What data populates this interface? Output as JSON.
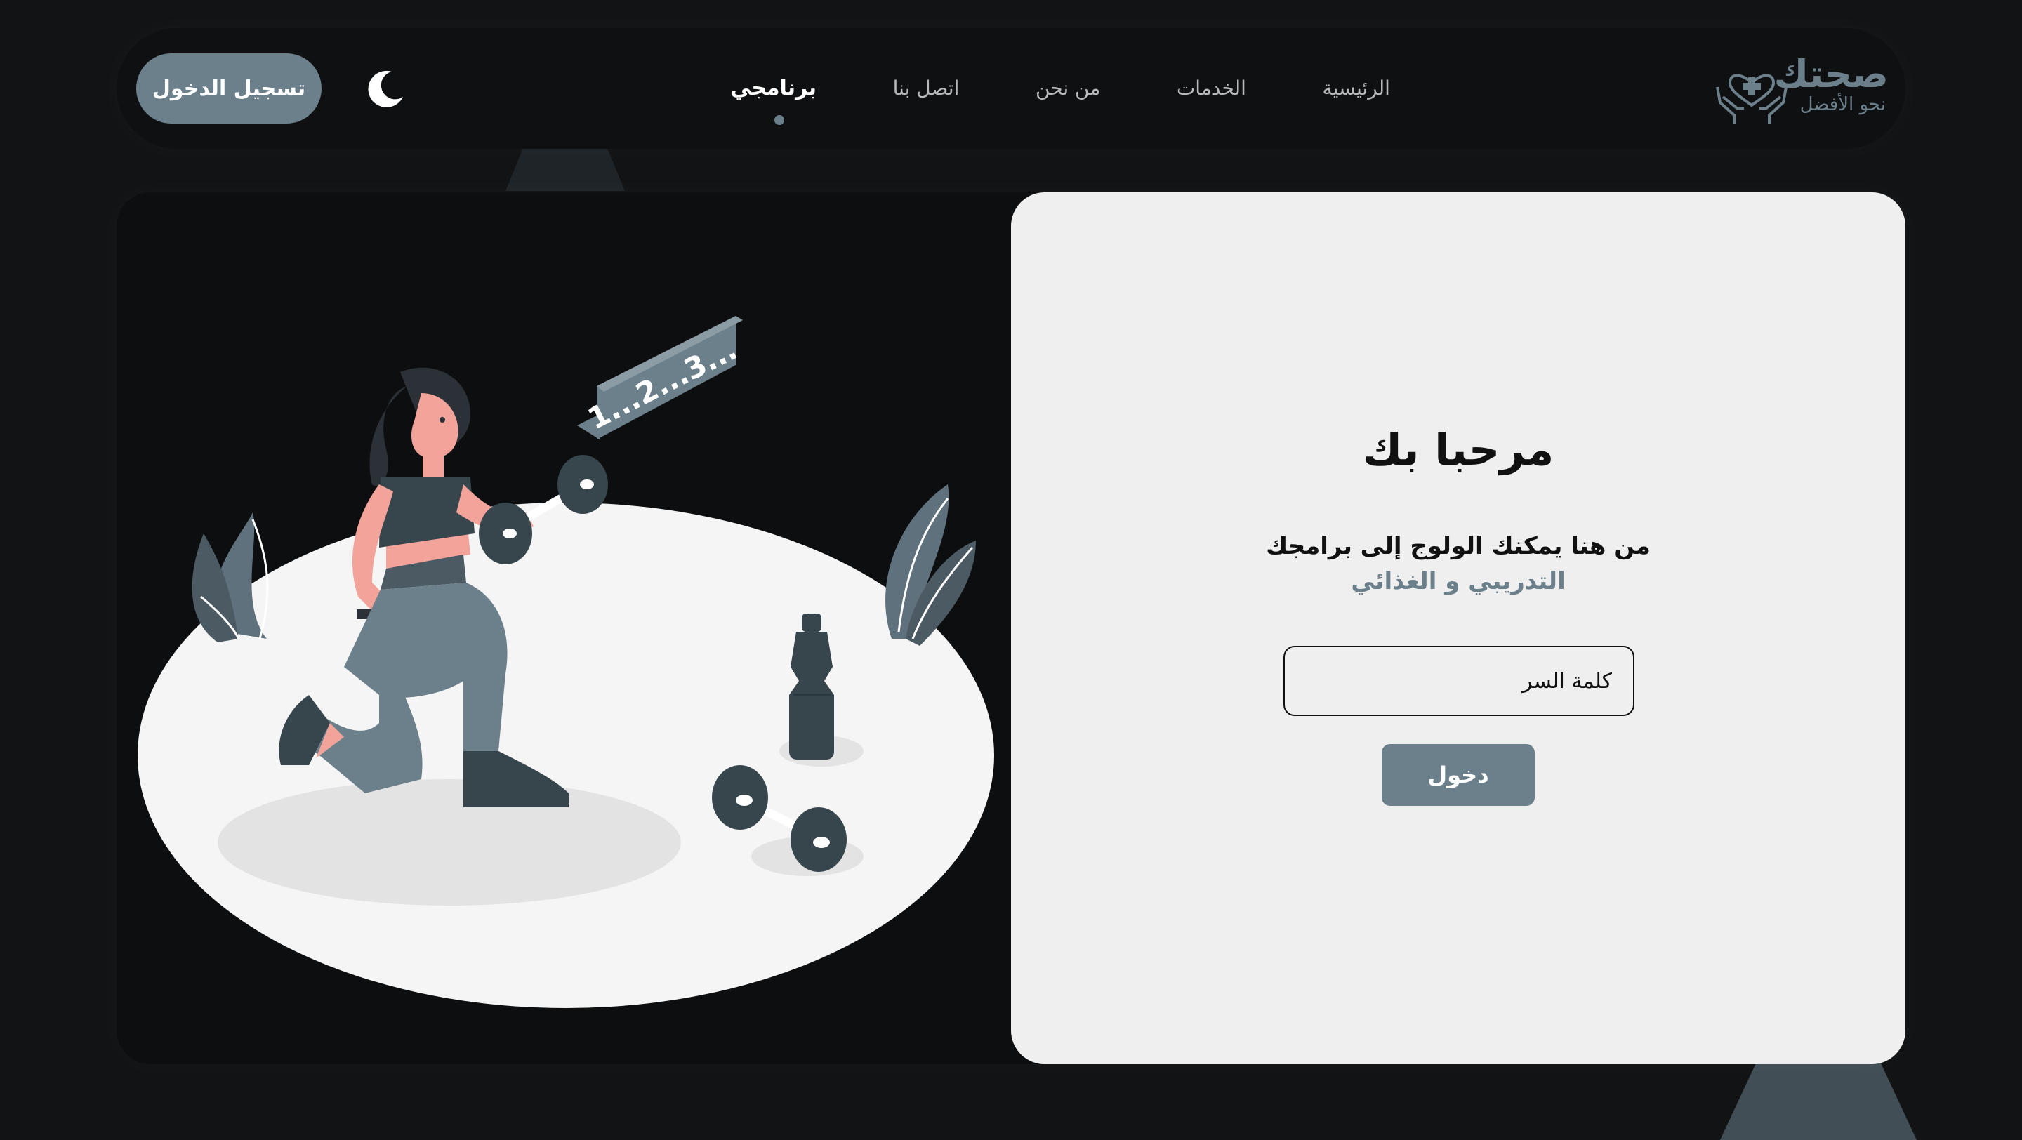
{
  "navbar": {
    "login_label": "تسجيل الدخول",
    "links": [
      {
        "label": "الرئيسية"
      },
      {
        "label": "الخدمات"
      },
      {
        "label": "من نحن"
      },
      {
        "label": "اتصل بنا"
      },
      {
        "label": "برنامجي",
        "active": true
      }
    ],
    "logo": {
      "title": "صحتك",
      "subtitle": "نحو الأفضل"
    },
    "theme_icon": "moon-icon"
  },
  "illustration": {
    "counter_text": "1...2...3..."
  },
  "login": {
    "title": "مرحبا بك",
    "line1": "من هنا يمكنك الولوج إلى برامجك",
    "line2": "التدريبي و الغذائي",
    "password_placeholder": "كلمة السر",
    "submit_label": "دخول"
  },
  "colors": {
    "accent": "#6c808c",
    "background": "#121314",
    "panel": "#efefef"
  }
}
